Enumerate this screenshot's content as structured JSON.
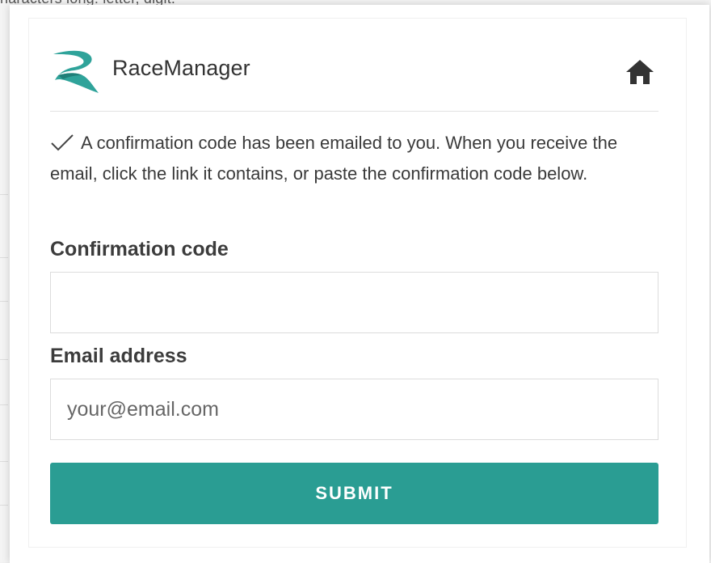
{
  "background": {
    "partial_text": "naracters long: letter, digit."
  },
  "header": {
    "brand": "RaceManager",
    "logo_icon": "racemanager-r-logo",
    "home_icon": "home-icon"
  },
  "message": {
    "icon": "check-icon",
    "text": "A confirmation code has been emailed to you. When you receive the email, click the link it contains, or paste the confirmation code below."
  },
  "form": {
    "confirmation_label": "Confirmation code",
    "confirmation_value": "",
    "confirmation_placeholder": "",
    "email_label": "Email address",
    "email_value": "",
    "email_placeholder": "your@email.com",
    "submit_label": "SUBMIT"
  },
  "colors": {
    "accent": "#2a9d93",
    "logo_teal": "#2fa39a"
  }
}
